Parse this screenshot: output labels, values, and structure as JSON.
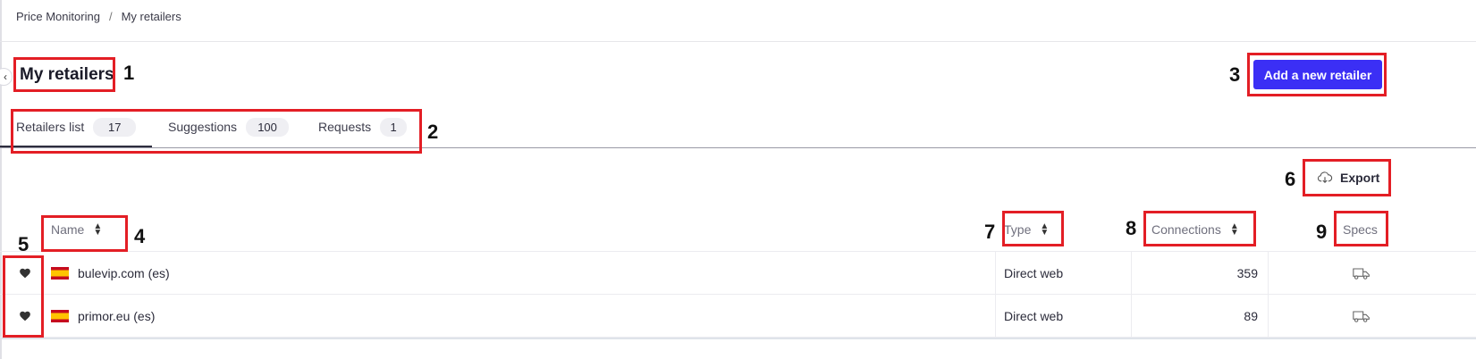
{
  "breadcrumb": {
    "root": "Price Monitoring",
    "separator": "/",
    "current": "My retailers"
  },
  "page": {
    "title": "My retailers",
    "collapse_icon": "‹"
  },
  "actions": {
    "add_label": "Add a new retailer",
    "export_label": "Export",
    "export_icon": "cloud-download-icon"
  },
  "tabs": [
    {
      "label": "Retailers list",
      "count": "17",
      "active": true
    },
    {
      "label": "Suggestions",
      "count": "100",
      "active": false
    },
    {
      "label": "Requests",
      "count": "1",
      "active": false
    }
  ],
  "table": {
    "columns": {
      "name": "Name",
      "type": "Type",
      "connections": "Connections",
      "specs": "Specs"
    },
    "rows": [
      {
        "favorite": true,
        "flag": "es",
        "name": "bulevip.com (es)",
        "type": "Direct web",
        "connections": "359",
        "specs_icon": "truck-icon"
      },
      {
        "favorite": true,
        "flag": "es",
        "name": "primor.eu (es)",
        "type": "Direct web",
        "connections": "89",
        "specs_icon": "truck-icon"
      }
    ]
  },
  "annotations": [
    "1",
    "2",
    "3",
    "4",
    "5",
    "6",
    "7",
    "8",
    "9"
  ],
  "colors": {
    "accent": "#3b2ff5",
    "annotation": "#e31e25",
    "flag_red": "#c60b1e",
    "flag_yellow": "#ffc400"
  }
}
